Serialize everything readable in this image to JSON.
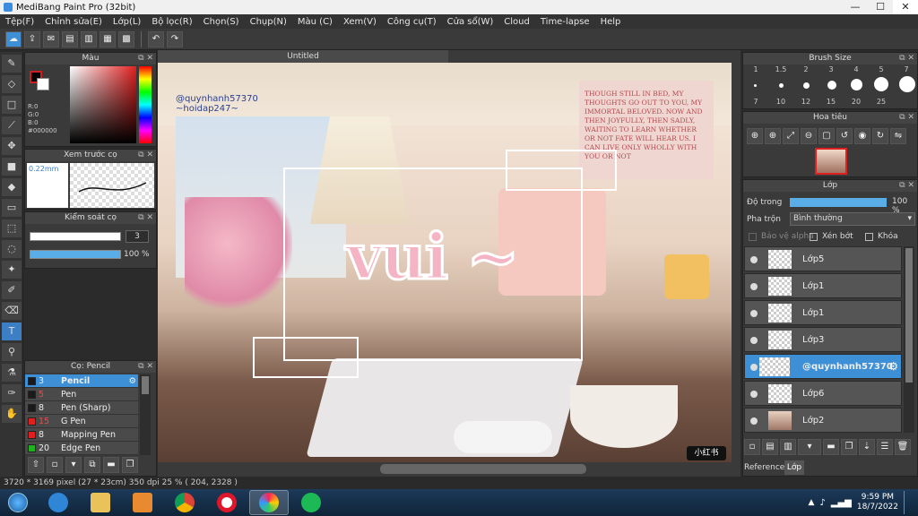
{
  "window": {
    "title": "MediBang Paint Pro (32bit)",
    "minimize": "—",
    "maximize": "☐",
    "close": "✕"
  },
  "menu": [
    "Tệp(F)",
    "Chỉnh sửa(E)",
    "Lớp(L)",
    "Bộ lọc(R)",
    "Chọn(S)",
    "Chụp(N)",
    "Màu (C)",
    "Xem(V)",
    "Công cụ(T)",
    "Cửa sổ(W)",
    "Cloud",
    "Time-lapse",
    "Help"
  ],
  "toolbar": {
    "undo": "↶",
    "redo": "↷"
  },
  "color_panel": {
    "title": "Màu",
    "r": "R:0",
    "g": "G:0",
    "b": "B:0",
    "hex": "#000000",
    "accent": "#cc1f1f"
  },
  "preview_panel": {
    "title": "Xem trước cọ",
    "size": "0.22mm"
  },
  "brush_control": {
    "title": "Kiểm soát cọ",
    "size_value": "3",
    "opacity_value": "100 %"
  },
  "brush_panel": {
    "title": "Cọ: Pencil",
    "items": [
      {
        "size": "3",
        "name": "Pencil",
        "color": "#1a1a1a"
      },
      {
        "size": "5",
        "name": "Pen",
        "color": "#1a1a1a"
      },
      {
        "size": "8",
        "name": "Pen (Sharp)",
        "color": "#1a1a1a"
      },
      {
        "size": "15",
        "name": "G Pen",
        "color": "#e02020"
      },
      {
        "size": "8",
        "name": "Mapping Pen",
        "color": "#e02020"
      },
      {
        "size": "20",
        "name": "Edge Pen",
        "color": "#20b020"
      }
    ]
  },
  "canvas": {
    "tab": "Untitled",
    "watermark": "@quynhanh57370",
    "watermark2": "~hoidap247~",
    "art_text": "vui ~",
    "sign_text": "小红书",
    "poster_text": "THOUGH STILL IN BED, MY THOUGHTS GO OUT TO YOU, MY IMMORTAL BELOVED. NOW AND THEN JOYFULLY, THEN SADLY, WAITING TO LEARN WHETHER OR NOT FATE WILL HEAR US. I CAN LIVE ONLY WHOLLY WITH YOU OR NOT"
  },
  "brush_size": {
    "title": "Brush Size",
    "row1": [
      "1",
      "1.5",
      "2",
      "3",
      "4",
      "5",
      "7"
    ],
    "row2": [
      "7",
      "10",
      "12",
      "15",
      "20",
      "25"
    ]
  },
  "navigator": {
    "title": "Hoa tiêu"
  },
  "layers": {
    "title": "Lớp",
    "opacity_label": "Độ trong",
    "opacity_value": "100 %",
    "blend_label": "Pha trộn",
    "blend_value": "Bình thường",
    "protect_alpha": "Bảo vệ alpha",
    "clip": "Xén bớt",
    "lock": "Khóa",
    "items": [
      {
        "name": "Lớp5"
      },
      {
        "name": "Lớp1"
      },
      {
        "name": "Lớp1"
      },
      {
        "name": "Lớp3"
      },
      {
        "name": "@quynhanh57370"
      },
      {
        "name": "Lớp6"
      },
      {
        "name": "Lớp2"
      }
    ],
    "tab_reference": "Reference",
    "tab_layer": "Lớp"
  },
  "status": {
    "text": "3720 * 3169 pixel  (27 * 23cm)  350 dpi  25 %  ( 204, 2328 )"
  },
  "taskbar": {
    "time": "9:59 PM",
    "date": "18/7/2022"
  }
}
